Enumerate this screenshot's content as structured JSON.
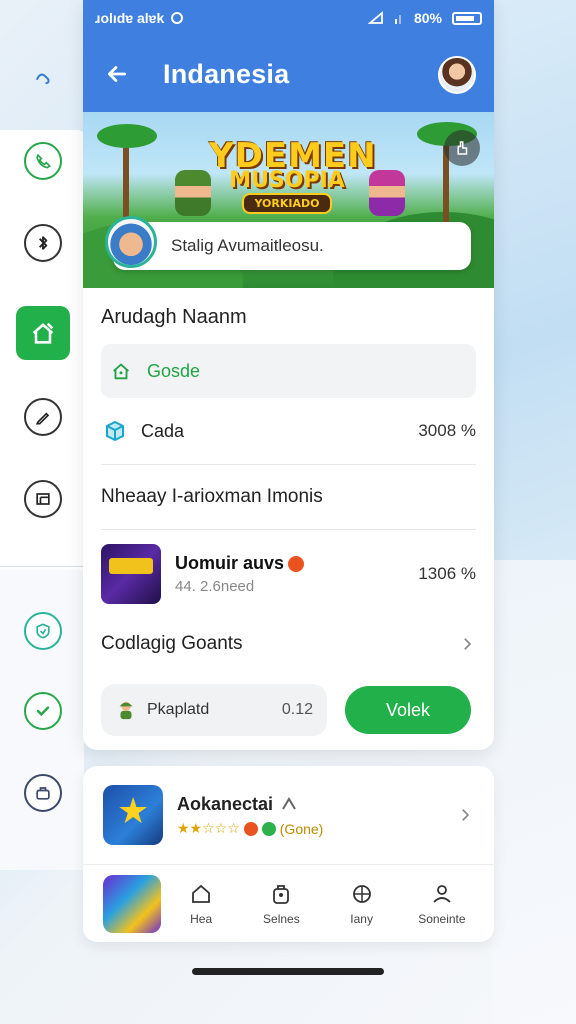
{
  "status_bar": {
    "carrier": "ɹolıdɐ alɐk",
    "battery": "80%"
  },
  "header": {
    "title": "Indanesia",
    "back_icon": "arrow-left-icon"
  },
  "banner": {
    "logo_line1": "YDEMEN",
    "logo_line2": "MUSOPIA",
    "logo_badge": "YORKIADO",
    "search_placeholder": "Stalig Avumaitleosu."
  },
  "main": {
    "section_title": "Arudagh Naanm",
    "items": [
      {
        "label": "Gosde",
        "value": ""
      },
      {
        "label": "Cada",
        "value": "3008 %"
      }
    ],
    "subsection_title": "Nheaay I-arioxman Imonis",
    "game": {
      "name": "Uomuir auvs",
      "meta": "44. 2.6need",
      "value": "1306 %"
    },
    "link_row": "Codlagig Goants",
    "pill": {
      "label": "Pkaplatd",
      "value": "0.12"
    },
    "primary_button": "Volek"
  },
  "card2": {
    "app_name": "Aokanectai",
    "rating_text": "(Gone)",
    "nav": [
      {
        "label": "Hea",
        "icon": "home-icon"
      },
      {
        "label": "Selnes",
        "icon": "bag-icon"
      },
      {
        "label": "Iany",
        "icon": "compass-icon"
      },
      {
        "label": "Soneinte",
        "icon": "profile-icon"
      }
    ]
  },
  "colors": {
    "header_blue": "#3f7fe0",
    "accent_green": "#22b04b",
    "rail_teal": "#2bb39a"
  }
}
